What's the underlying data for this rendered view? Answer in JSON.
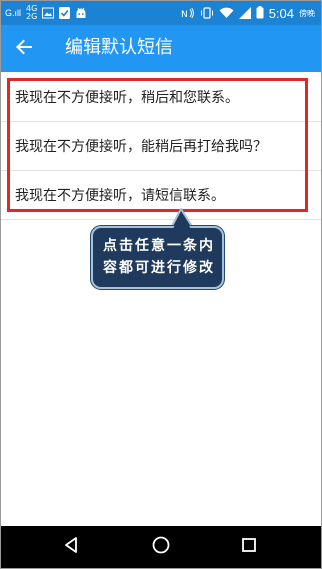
{
  "status_bar": {
    "signal_top": "G.ıll",
    "signal_mid": "4G",
    "signal_bot": "2G",
    "time": "5:04",
    "sub_label": "傍晚"
  },
  "app_bar": {
    "title": "编辑默认短信"
  },
  "messages": [
    "我现在不方便接听，稍后和您联系。",
    "我现在不方便接听，能稍后再打给我吗？",
    "我现在不方便接听，请短信联系。"
  ],
  "callout": {
    "text": "点击任意一条内容都可进行修改"
  },
  "colors": {
    "status_bar": "#1c82d4",
    "app_bar": "#2196f3",
    "highlight": "#e0282c",
    "callout_bg": "#1f3a5c",
    "callout_border": "#a5c2dc",
    "nav_bar": "#000000"
  },
  "icons": {
    "back": "arrow-left-icon",
    "nav_back": "triangle-back-icon",
    "nav_home": "circle-home-icon",
    "nav_recent": "square-recent-icon"
  }
}
